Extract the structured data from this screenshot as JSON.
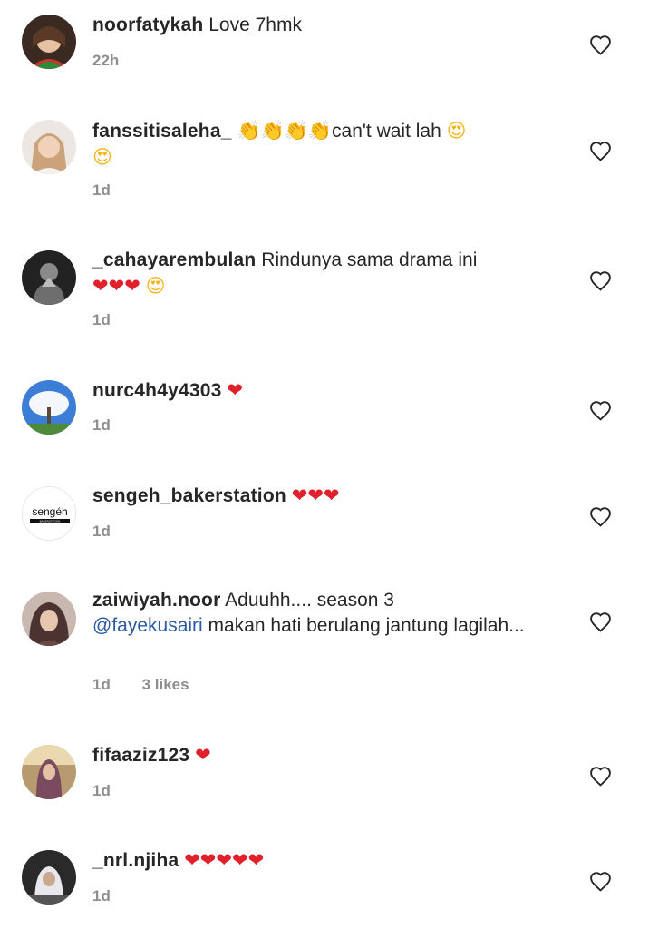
{
  "comments": [
    {
      "username": "noorfatykah",
      "text": "Love 7hmk",
      "time": "22h",
      "likes": ""
    },
    {
      "username": "fanssitisaleha_",
      "text_emoji": "👏👏👏👏",
      "text": "can't wait lah",
      "text_emoji_2": "😍",
      "text_emoji_3": "😍",
      "time": "1d",
      "likes": ""
    },
    {
      "username": "_cahayarembulan",
      "text": "Rindunya sama drama ini",
      "text_emoji": "❤❤❤",
      "text_emoji_2": "😍",
      "time": "1d",
      "likes": ""
    },
    {
      "username": "nurc4h4y4303",
      "text_emoji": "❤",
      "time": "1d",
      "likes": ""
    },
    {
      "username": "sengeh_bakerstation",
      "text_emoji": "❤❤❤",
      "time": "1d",
      "likes": ""
    },
    {
      "username": "zaiwiyah.noor",
      "text": "Aduuhh.... season 3",
      "mention": "@fayekusairi",
      "text_2": "makan hati berulang jantung lagilah...",
      "time": "1d",
      "likes": "3 likes"
    },
    {
      "username": "fifaaziz123",
      "text_emoji": "❤",
      "time": "1d",
      "likes": ""
    },
    {
      "username": "_nrl.njiha",
      "text_emoji": "❤❤❤❤❤",
      "time": "1d",
      "likes": ""
    }
  ],
  "avatars": {
    "sengeh_logo_text": "sengéh",
    "sengeh_logo_subtext": "BAKERSTATION"
  },
  "colors": {
    "username": "#262626",
    "meta": "#8e8e8e",
    "mention": "#2b5aa0",
    "heart_emoji": "#e0202a"
  },
  "icons": {
    "like": "heart-outline-icon"
  }
}
